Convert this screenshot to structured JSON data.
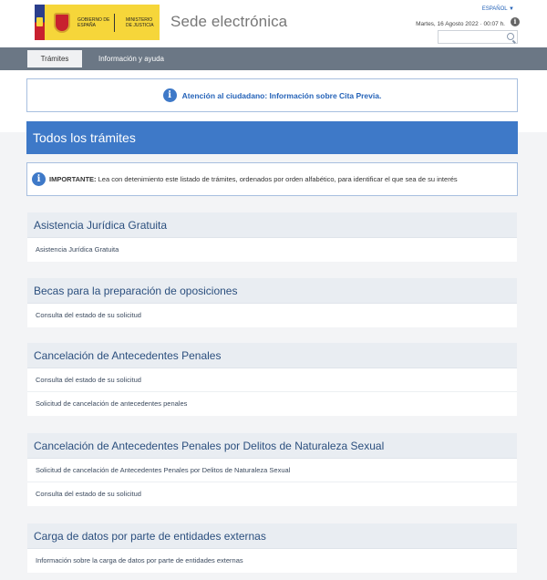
{
  "header": {
    "logo_left": "Gobierno de España",
    "logo_right": "Ministerio de Justicia",
    "site_title": "Sede electrónica",
    "language": "ESPAÑOL ▼",
    "datetime": "Martes, 16 Agosto 2022 · 00:07 h.",
    "search_placeholder": ""
  },
  "nav": {
    "tabs": [
      {
        "label": "Trámites"
      },
      {
        "label": "Información y ayuda"
      }
    ]
  },
  "notice": {
    "text": "Atención al ciudadano: Información sobre Cita Previa."
  },
  "page_title": "Todos los trámites",
  "importante": {
    "label": "IMPORTANTE:",
    "text": " Lea con detenimiento este listado de trámites, ordenados por orden alfabético, para identificar el que sea de su interés"
  },
  "sections": [
    {
      "title": "Asistencia Jurídica Gratuita",
      "items": [
        "Asistencia Jurídica Gratuita"
      ]
    },
    {
      "title": "Becas para la preparación de oposiciones",
      "items": [
        "Consulta del estado de su solicitud"
      ]
    },
    {
      "title": "Cancelación de Antecedentes Penales",
      "items": [
        "Consulta del estado de su solicitud",
        "Solicitud de cancelación de antecedentes penales"
      ]
    },
    {
      "title": "Cancelación de Antecedentes Penales por Delitos de Naturaleza Sexual",
      "items": [
        "Solicitud de cancelación de Antecedentes Penales por Delitos de Naturaleza Sexual",
        "Consulta del estado de su solicitud"
      ]
    },
    {
      "title": "Carga de datos por parte de entidades externas",
      "items": [
        "Información sobre la carga de datos por parte de entidades externas"
      ]
    }
  ],
  "colors": {
    "primary_blue": "#3e79c8",
    "nav_gray": "#6b7785",
    "logo_yellow": "#f6d63a"
  }
}
